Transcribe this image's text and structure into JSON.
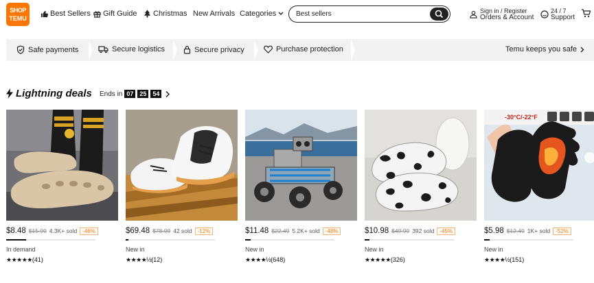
{
  "header": {
    "logo_line1": "SHOP",
    "logo_text": "TEMU",
    "nav": [
      {
        "label": "Best Sellers",
        "icon": "thumbs-up-icon"
      },
      {
        "label": "Gift Guide",
        "icon": "gift-icon"
      },
      {
        "label": "Christmas",
        "icon": "tree-icon"
      },
      {
        "label": "New Arrivals"
      },
      {
        "label": "Categories",
        "icon": "chevron-down-icon"
      }
    ],
    "search_value": "Best sellers",
    "signin_line1": "Sign in / Register",
    "signin_line2": "Orders & Account",
    "support_line1": "24 / 7",
    "support_line2": "Support"
  },
  "trust": {
    "items": [
      {
        "label": "Safe payments",
        "icon": "shield-check-icon"
      },
      {
        "label": "Secure logistics",
        "icon": "truck-icon"
      },
      {
        "label": "Secure privacy",
        "icon": "lock-icon"
      },
      {
        "label": "Purchase protection",
        "icon": "heart-shield-icon"
      }
    ],
    "right_label": "Temu keeps you safe"
  },
  "deals": {
    "title": "Lightning deals",
    "ends_label": "Ends in",
    "hours": "07",
    "minutes": "25",
    "seconds": "54"
  },
  "products": [
    {
      "name": "Foam runner slides",
      "price": "$8.48",
      "orig": "$15.99",
      "sold": "4.3K+ sold",
      "discount": "-46%",
      "tag": "In demand",
      "stars": "★★★★★",
      "reviews": "(41)",
      "progress": 0.22
    },
    {
      "name": "White running sneakers",
      "price": "$69.48",
      "orig": "$78.99",
      "sold": "42 sold",
      "discount": "-12%",
      "tag": "New in",
      "stars": "★★★★½",
      "reviews": "(12)",
      "progress": 0.03
    },
    {
      "name": "Solar robot car kit",
      "price": "$11.48",
      "orig": "$22.49",
      "sold": "5.2K+ sold",
      "discount": "-48%",
      "tag": "New in",
      "stars": "★★★★½",
      "reviews": "(648)",
      "progress": 0.06
    },
    {
      "name": "Cow print loafers",
      "price": "$10.98",
      "orig": "$49.99",
      "sold": "392 sold",
      "discount": "-45%",
      "tag": "New in",
      "stars": "★★★★★",
      "reviews": "(326)",
      "progress": 0.05
    },
    {
      "name": "Heated winter gloves",
      "price": "$5.98",
      "orig": "$12.49",
      "sold": "1K+ sold",
      "discount": "-52%",
      "tag": "New in",
      "stars": "★★★★½",
      "reviews": "(151)",
      "progress": 0.06
    }
  ],
  "overlay": {
    "temp_text": "-30°C/-22°F"
  },
  "colors": {
    "brand": "#fb7701",
    "trust_bg": "#f2f2f2"
  }
}
